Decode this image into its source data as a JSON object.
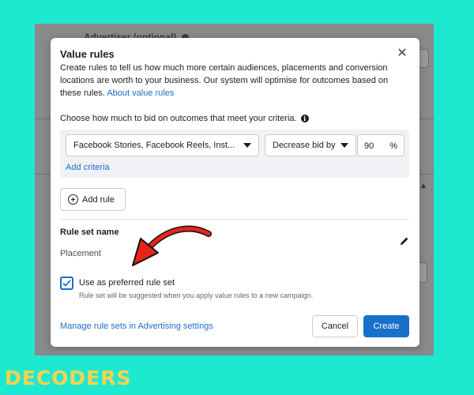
{
  "background": {
    "header_text": "Advertiser (optional)"
  },
  "modal": {
    "title": "Value rules",
    "description": "Create rules to tell us how much more certain audiences, placements and conversion locations are worth to your business. Our system will optimise for outcomes based on these rules.",
    "about_link": "About value rules",
    "choose_text": "Choose how much to bid on outcomes that meet your criteria.",
    "criteria": {
      "dropdown_value": "Facebook Stories, Facebook Reels, Inst...",
      "bid_action": "Decrease bid by",
      "percent_value": "90",
      "percent_unit": "%",
      "add_criteria_label": "Add criteria"
    },
    "add_rule_label": "Add rule",
    "rule_set_name_label": "Rule set name",
    "rule_set_name_value": "Placement",
    "preferred": {
      "checked": true,
      "label": "Use as preferred rule set",
      "sublabel": "Rule set will be suggested when you apply value rules to a new campaign."
    },
    "manage_link": "Manage rule sets in Advertising settings",
    "cancel_label": "Cancel",
    "create_label": "Create"
  },
  "colors": {
    "page_bg": "#1de9d0",
    "accent_blue": "#1a6fc9",
    "arrow_red": "#e8231a",
    "logo_yellow": "#ffd24a"
  },
  "watermark": "DECODERS"
}
